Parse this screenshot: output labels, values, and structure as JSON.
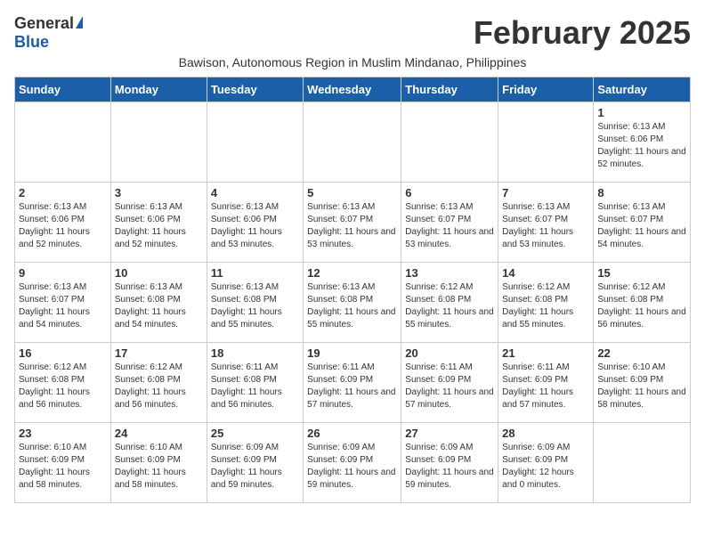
{
  "logo": {
    "general": "General",
    "blue": "Blue"
  },
  "title": "February 2025",
  "location": "Bawison, Autonomous Region in Muslim Mindanao, Philippines",
  "headers": [
    "Sunday",
    "Monday",
    "Tuesday",
    "Wednesday",
    "Thursday",
    "Friday",
    "Saturday"
  ],
  "weeks": [
    [
      {
        "day": "",
        "info": ""
      },
      {
        "day": "",
        "info": ""
      },
      {
        "day": "",
        "info": ""
      },
      {
        "day": "",
        "info": ""
      },
      {
        "day": "",
        "info": ""
      },
      {
        "day": "",
        "info": ""
      },
      {
        "day": "1",
        "info": "Sunrise: 6:13 AM\nSunset: 6:06 PM\nDaylight: 11 hours and 52 minutes."
      }
    ],
    [
      {
        "day": "2",
        "info": "Sunrise: 6:13 AM\nSunset: 6:06 PM\nDaylight: 11 hours and 52 minutes."
      },
      {
        "day": "3",
        "info": "Sunrise: 6:13 AM\nSunset: 6:06 PM\nDaylight: 11 hours and 52 minutes."
      },
      {
        "day": "4",
        "info": "Sunrise: 6:13 AM\nSunset: 6:06 PM\nDaylight: 11 hours and 53 minutes."
      },
      {
        "day": "5",
        "info": "Sunrise: 6:13 AM\nSunset: 6:07 PM\nDaylight: 11 hours and 53 minutes."
      },
      {
        "day": "6",
        "info": "Sunrise: 6:13 AM\nSunset: 6:07 PM\nDaylight: 11 hours and 53 minutes."
      },
      {
        "day": "7",
        "info": "Sunrise: 6:13 AM\nSunset: 6:07 PM\nDaylight: 11 hours and 53 minutes."
      },
      {
        "day": "8",
        "info": "Sunrise: 6:13 AM\nSunset: 6:07 PM\nDaylight: 11 hours and 54 minutes."
      }
    ],
    [
      {
        "day": "9",
        "info": "Sunrise: 6:13 AM\nSunset: 6:07 PM\nDaylight: 11 hours and 54 minutes."
      },
      {
        "day": "10",
        "info": "Sunrise: 6:13 AM\nSunset: 6:08 PM\nDaylight: 11 hours and 54 minutes."
      },
      {
        "day": "11",
        "info": "Sunrise: 6:13 AM\nSunset: 6:08 PM\nDaylight: 11 hours and 55 minutes."
      },
      {
        "day": "12",
        "info": "Sunrise: 6:13 AM\nSunset: 6:08 PM\nDaylight: 11 hours and 55 minutes."
      },
      {
        "day": "13",
        "info": "Sunrise: 6:12 AM\nSunset: 6:08 PM\nDaylight: 11 hours and 55 minutes."
      },
      {
        "day": "14",
        "info": "Sunrise: 6:12 AM\nSunset: 6:08 PM\nDaylight: 11 hours and 55 minutes."
      },
      {
        "day": "15",
        "info": "Sunrise: 6:12 AM\nSunset: 6:08 PM\nDaylight: 11 hours and 56 minutes."
      }
    ],
    [
      {
        "day": "16",
        "info": "Sunrise: 6:12 AM\nSunset: 6:08 PM\nDaylight: 11 hours and 56 minutes."
      },
      {
        "day": "17",
        "info": "Sunrise: 6:12 AM\nSunset: 6:08 PM\nDaylight: 11 hours and 56 minutes."
      },
      {
        "day": "18",
        "info": "Sunrise: 6:11 AM\nSunset: 6:08 PM\nDaylight: 11 hours and 56 minutes."
      },
      {
        "day": "19",
        "info": "Sunrise: 6:11 AM\nSunset: 6:09 PM\nDaylight: 11 hours and 57 minutes."
      },
      {
        "day": "20",
        "info": "Sunrise: 6:11 AM\nSunset: 6:09 PM\nDaylight: 11 hours and 57 minutes."
      },
      {
        "day": "21",
        "info": "Sunrise: 6:11 AM\nSunset: 6:09 PM\nDaylight: 11 hours and 57 minutes."
      },
      {
        "day": "22",
        "info": "Sunrise: 6:10 AM\nSunset: 6:09 PM\nDaylight: 11 hours and 58 minutes."
      }
    ],
    [
      {
        "day": "23",
        "info": "Sunrise: 6:10 AM\nSunset: 6:09 PM\nDaylight: 11 hours and 58 minutes."
      },
      {
        "day": "24",
        "info": "Sunrise: 6:10 AM\nSunset: 6:09 PM\nDaylight: 11 hours and 58 minutes."
      },
      {
        "day": "25",
        "info": "Sunrise: 6:09 AM\nSunset: 6:09 PM\nDaylight: 11 hours and 59 minutes."
      },
      {
        "day": "26",
        "info": "Sunrise: 6:09 AM\nSunset: 6:09 PM\nDaylight: 11 hours and 59 minutes."
      },
      {
        "day": "27",
        "info": "Sunrise: 6:09 AM\nSunset: 6:09 PM\nDaylight: 11 hours and 59 minutes."
      },
      {
        "day": "28",
        "info": "Sunrise: 6:09 AM\nSunset: 6:09 PM\nDaylight: 12 hours and 0 minutes."
      },
      {
        "day": "",
        "info": ""
      }
    ]
  ]
}
